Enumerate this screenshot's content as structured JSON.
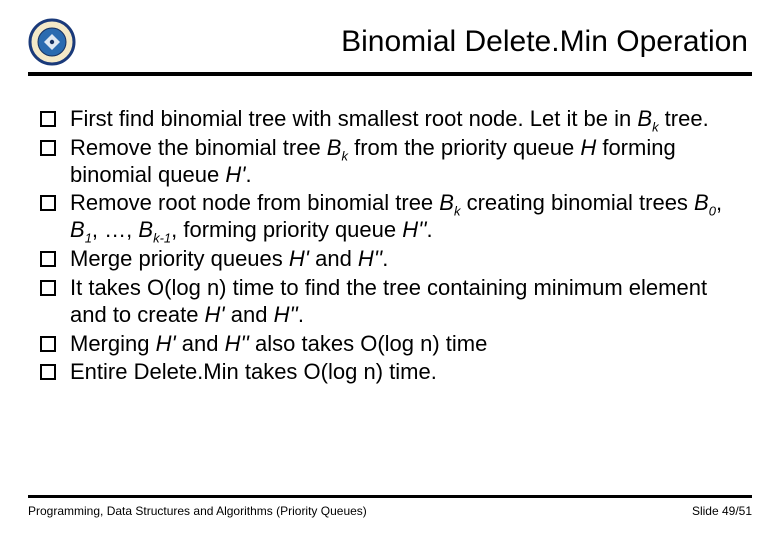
{
  "header": {
    "title": "Binomial Delete.Min Operation"
  },
  "bullets": [
    {
      "html": "First find binomial tree with smallest root node. Let it be in <i>B<sub>k</sub></i> tree."
    },
    {
      "html": "Remove the binomial tree <i>B<sub>k</sub></i> from the priority queue <i>H</i> forming binomial queue <i>H'</i>."
    },
    {
      "html": "Remove root node from binomial tree <i>B<sub>k</sub></i> creating binomial trees <i>B<sub>0</sub></i>, <i>B<sub>1</sub></i>, …, <i>B<sub>k-1</sub></i>, forming priority queue <i>H''</i>."
    },
    {
      "html": "Merge priority queues <i>H'</i> and <i>H''</i>."
    },
    {
      "html": "It takes O(log n) time to find the tree containing minimum element and to create <i>H'</i> and <i>H''</i>."
    },
    {
      "html": "Merging <i>H'</i> and <i>H''</i> also takes O(log n) time"
    },
    {
      "html": "Entire Delete.Min takes O(log n) time."
    }
  ],
  "footer": {
    "left": "Programming, Data Structures and Algorithms  (Priority Queues)",
    "right": "Slide 49/51"
  }
}
